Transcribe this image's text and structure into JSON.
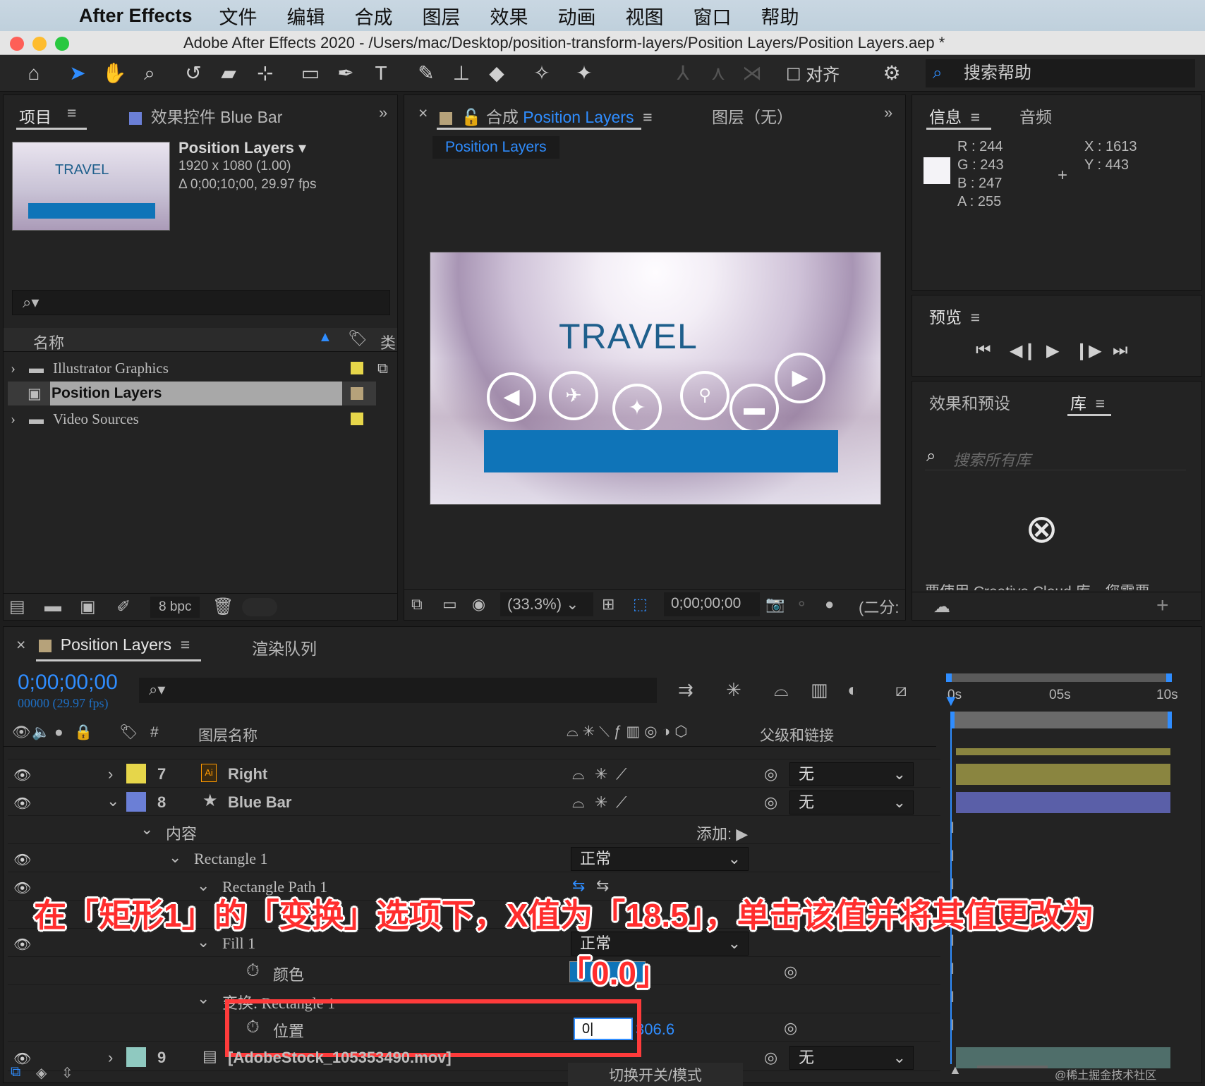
{
  "menubar": {
    "app_name": "After Effects",
    "items": [
      "文件",
      "编辑",
      "合成",
      "图层",
      "效果",
      "动画",
      "视图",
      "窗口",
      "帮助"
    ]
  },
  "window": {
    "title": "Adobe After Effects 2020 - /Users/mac/Desktop/position-transform-layers/Position Layers/Position Layers.aep *"
  },
  "toolbar": {
    "align_label": "对齐",
    "help_placeholder": "搜索帮助"
  },
  "project_panel": {
    "tab_label": "项目",
    "effects_tab_label": "效果控件 Blue Bar",
    "comp_name": "Position Layers",
    "comp_size": "1920 x 1080 (1.00)",
    "comp_duration": "Δ 0;00;10;00, 29.97 fps",
    "thumb_text": "TRAVEL",
    "col_name": "名称",
    "col_type": "类",
    "items": [
      {
        "name": "Illustrator Graphics",
        "color": "#e6d64a"
      },
      {
        "name": "Position Layers",
        "color": "#b6a27a"
      },
      {
        "name": "Video Sources",
        "color": "#e6d64a"
      }
    ],
    "bpc": "8 bpc"
  },
  "comp_panel": {
    "tab_prefix": "合成",
    "tab_name": "Position Layers",
    "layer_tab": "图层（无）",
    "breadcrumb": "Position Layers",
    "viewer_title": "TRAVEL",
    "zoom": "(33.3%)",
    "timecode": "0;00;00;00",
    "resolution": "(二分:"
  },
  "info_panel": {
    "tab_info": "信息",
    "tab_audio": "音频",
    "r": "R :  244",
    "g": "G :  243",
    "b": "B :  247",
    "a": "A :  255",
    "x": "X : 1613",
    "y": "Y :  443"
  },
  "preview_panel": {
    "title": "预览"
  },
  "effects_panel": {
    "title": "效果和预设",
    "library_tab": "库",
    "search_placeholder": "搜索所有库",
    "cc_notice": "要使用 Creative Cloud 库，您需要"
  },
  "timeline": {
    "tab_name": "Position Layers",
    "render_queue": "渲染队列",
    "timecode": "0;00;00;00",
    "frames": "00000 (29.97 fps)",
    "col_num": "#",
    "col_layer_name": "图层名称",
    "col_parent": "父级和链接",
    "ruler": [
      "0s",
      "05s",
      "10s"
    ],
    "rows": {
      "layer7": {
        "num": "7",
        "name": "Right",
        "parent": "无",
        "color": "#e6d64a"
      },
      "layer8": {
        "num": "8",
        "name": "Blue Bar",
        "parent": "无",
        "color": "#6b7fd6"
      },
      "contents": "内容",
      "add_label": "添加:",
      "rect1": "Rectangle 1",
      "rect1_mode": "正常",
      "rect_path": "Rectangle Path 1",
      "fill": "Fill 1",
      "fill_mode": "正常",
      "color": "颜色",
      "transform": "变换: Rectangle 1",
      "position": "位置",
      "position_x_input": "0",
      "position_y": "306.6",
      "layer9": {
        "num": "9",
        "name": "[AdobeStock_105353490.mov]",
        "parent": "无",
        "color": "#8fc9c0"
      }
    },
    "switch_mode": "切换开关/模式"
  },
  "annotation": {
    "line1": "在「矩形1」的「变换」选项下，X值为「18.5」，单击该值并将其值更改为",
    "line2": "「0.0」"
  },
  "watermark": "@稀土掘金技术社区"
}
